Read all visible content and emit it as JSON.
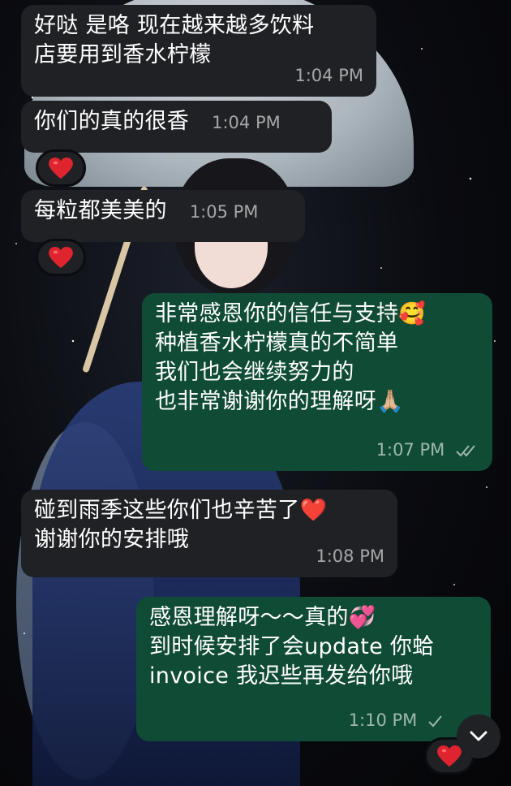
{
  "messages": [
    {
      "text": "好哒 是咯 现在越来越多饮料\n店要用到香水柠檬",
      "time": "1:04 PM",
      "direction": "incoming"
    },
    {
      "text": "你们的真的很香",
      "time": "1:04 PM",
      "direction": "incoming",
      "reaction": "red-heart"
    },
    {
      "text": "每粒都美美的",
      "time": "1:05 PM",
      "direction": "incoming",
      "reaction": "red-heart"
    },
    {
      "text": "非常感恩你的信任与支持🥰\n种植香水柠檬真的不简单\n我们也会继续努力的\n也非常谢谢你的理解呀🙏🏼",
      "time": "1:07 PM",
      "direction": "outgoing",
      "status": "read"
    },
    {
      "text": "碰到雨季这些你们也辛苦了❤️\n谢谢你的安排哦",
      "time": "1:08 PM",
      "direction": "incoming"
    },
    {
      "text": "感恩理解呀～～真的💞\n到时候安排了会update 你蛤\ninvoice 我迟些再发给你哦",
      "time": "1:10 PM",
      "direction": "outgoing",
      "status": "delivered",
      "reaction": "red-heart"
    }
  ],
  "colors": {
    "incoming_bubble": "#202124",
    "outgoing_bubble": "#0f4b35",
    "heart": "#e0242f"
  },
  "icons": {
    "reaction": "red-heart-icon",
    "scroll_down": "chevron-down-icon",
    "read_receipt": "double-check-icon"
  }
}
